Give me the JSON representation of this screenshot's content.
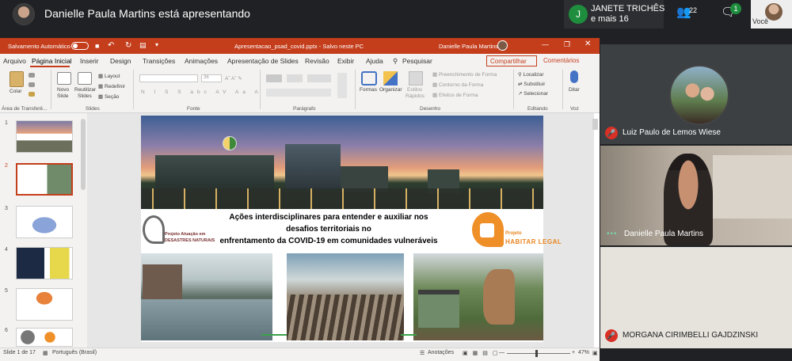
{
  "meet": {
    "presenter_text": "Danielle Paula Martins está apresentando",
    "featured_participant": {
      "initial": "J",
      "name": "JANETE TRICHÊS",
      "more": "e mais 16"
    },
    "people_count": "22",
    "chat_badge": "1",
    "self_label": "Você",
    "tiles": [
      {
        "name": "Luiz Paulo de Lemos Wiese"
      },
      {
        "name": "Danielle Paula Martins"
      },
      {
        "name": "MORGANA CIRIMBELLI GAJDZINSKI"
      }
    ]
  },
  "ppt": {
    "autosave_label": "Salvamento Automático",
    "doc_title": "Apresentacao_psad_covid.pptx  -  Salvo neste PC",
    "user_name": "Danielle Paula Martins",
    "tabs": [
      "Arquivo",
      "Página Inicial",
      "Inserir",
      "Design",
      "Transições",
      "Animações",
      "Apresentação de Slides",
      "Revisão",
      "Exibir",
      "Ajuda"
    ],
    "search_label": "Pesquisar",
    "share_label": "Compartilhar",
    "comments_label": "Comentários",
    "ribbon": {
      "paste": "Colar",
      "clipboard_group": "Área de Transferê...",
      "new_slide_1": "Novo",
      "new_slide_2": "Slide",
      "reuse_1": "Reutilizar",
      "reuse_2": "Slides",
      "layout": "Layout",
      "reset": "Redefinir",
      "section": "Seção",
      "slides_group": "Slides",
      "font_group": "Fonte",
      "font_size": "36",
      "paragraph_group": "Parágrafo",
      "shapes": "Formas",
      "arrange": "Organizar",
      "quick_styles_1": "Estilos",
      "quick_styles_2": "Rápidos",
      "shape_fill": "Preenchimento de Forma",
      "shape_outline": "Contorno da Forma",
      "shape_effects": "Efeitos de Forma",
      "drawing_group": "Desenho",
      "find": "Localizar",
      "replace": "Substituir",
      "select": "Selecionar",
      "editing_group": "Editando",
      "dictate": "Ditar",
      "voice_group": "Voz"
    },
    "thumb_numbers": [
      "1",
      "2",
      "3",
      "4",
      "5",
      "6"
    ],
    "slide": {
      "title_line1": "Ações interdisciplinares para entender e auxiliar nos",
      "title_line2": "desafios territoriais no",
      "title_line3": "enfrentamento da COVID-19 em comunidades vulneráveis",
      "logo_left_line1": "Projeto Atuação em",
      "logo_left_line2": "DESASTRES NATURAIS",
      "logo_right_line1": "Projeto",
      "logo_right_line2": "HABITAR LEGAL"
    },
    "status": {
      "slide_counter": "Slide 1 de 17",
      "language": "Português (Brasil)",
      "notes": "Anotações",
      "zoom": "47%"
    }
  },
  "colors": {
    "ppt_accent": "#c43e1c",
    "meet_bg": "#202124",
    "mic_off": "#d93025",
    "meet_green": "#1e8e3e"
  }
}
